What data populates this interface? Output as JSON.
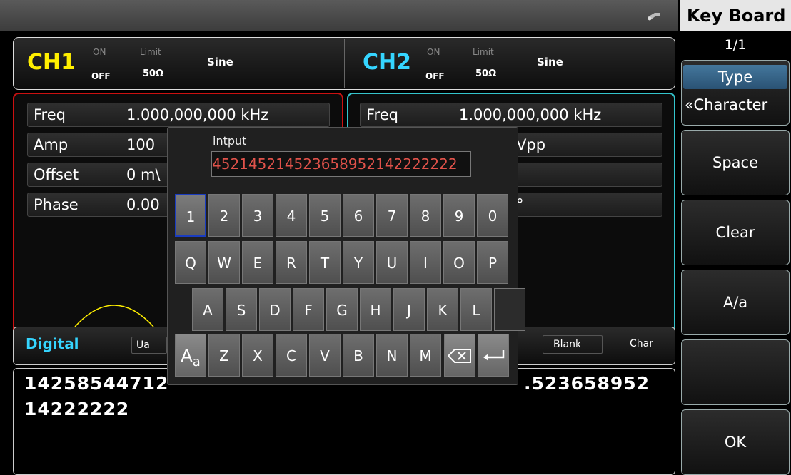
{
  "colors": {
    "ch1": "#ffef00",
    "ch2": "#35d5ff",
    "ch1_border": "#cc1111",
    "ch2_border": "#33c4cc",
    "input_text": "#e0524a"
  },
  "topbar": {
    "usb_icon": "usb-icon"
  },
  "softkeys": {
    "title": "Key Board",
    "page": "1/1",
    "type_label": "Type",
    "type_value": "«Character",
    "space": "Space",
    "clear": "Clear",
    "case": "A/a",
    "empty": "",
    "ok": "OK"
  },
  "ch1": {
    "name": "CH1",
    "on": "ON",
    "off": "OFF",
    "limit": "Limit",
    "load": "50Ω",
    "wave": "Sine"
  },
  "ch2": {
    "name": "CH2",
    "on": "ON",
    "off": "OFF",
    "limit": "Limit",
    "load": "50Ω",
    "wave": "Sine"
  },
  "ch1_params": [
    {
      "label": "Freq",
      "value": "1.000,000,000 kHz"
    },
    {
      "label": "Amp",
      "value": "100"
    },
    {
      "label": "Offset",
      "value": "0 m\\"
    },
    {
      "label": "Phase",
      "value": "0.00"
    }
  ],
  "ch2_params": [
    {
      "label": "Freq",
      "value": "1.000,000,000 kHz"
    },
    {
      "label": "",
      "value": "Vpp"
    },
    {
      "label": "",
      "value": ""
    },
    {
      "label": "",
      "value": "°"
    }
  ],
  "digital": {
    "title": "Digital",
    "ua": "Ua",
    "blank": "Blank",
    "char": "Char"
  },
  "data_line1_left": "14258544712",
  "data_line1_right": ".523658952",
  "data_line2": "14222222",
  "keyboard": {
    "label": "intput",
    "input": "452145214523658952142222222",
    "row1": [
      "1",
      "2",
      "3",
      "4",
      "5",
      "6",
      "7",
      "8",
      "9",
      "0"
    ],
    "row2": [
      "Q",
      "W",
      "E",
      "R",
      "T",
      "Y",
      "U",
      "I",
      "O",
      "P"
    ],
    "row3": [
      "A",
      "S",
      "D",
      "F",
      "G",
      "H",
      "J",
      "K",
      "L"
    ],
    "row4": [
      "Z",
      "X",
      "C",
      "V",
      "B",
      "N",
      "M"
    ],
    "case_key_big": "A",
    "case_key_small": "a"
  }
}
